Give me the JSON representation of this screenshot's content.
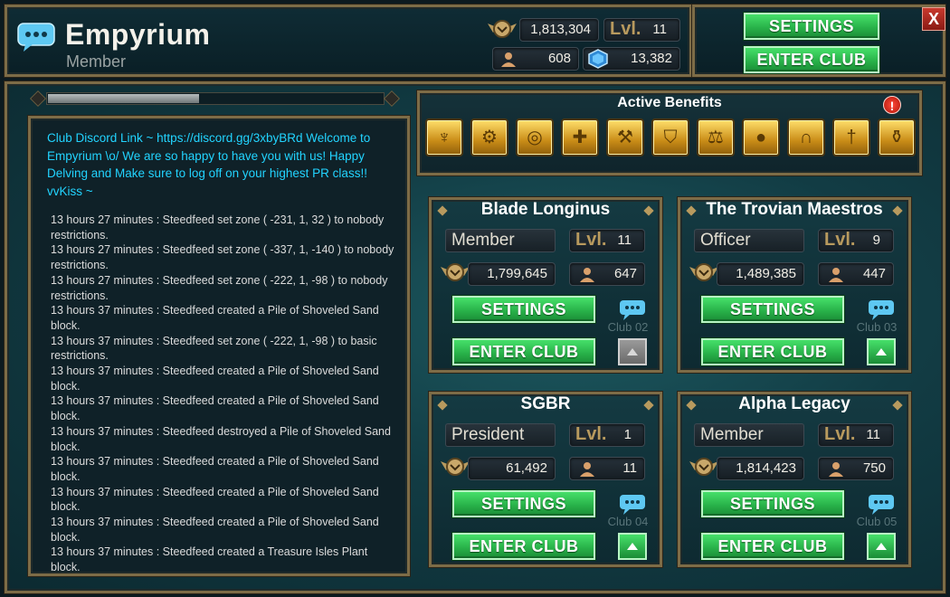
{
  "header": {
    "club_name": "Empyrium",
    "club_rank": "Member",
    "trophy_score": "1,813,304",
    "level_label": "Lvl.",
    "level_value": "11",
    "member_count": "608",
    "gem_count": "13,382",
    "settings_label": "SETTINGS",
    "enter_club_label": "ENTER CLUB",
    "close_label": "X"
  },
  "scroll": {
    "position": 0.45
  },
  "chat": {
    "motd": "Club Discord Link ~ https://discord.gg/3xbyBRd Welcome to Empyrium \\o/ We are so happy to have you with us! Happy Delving and Make sure to log off on your highest PR class!! vvKiss ~",
    "log": [
      "13 hours 27 minutes : Steedfeed set zone ( -231, 1, 32 ) to nobody restrictions.",
      "13 hours 27 minutes : Steedfeed set zone ( -337, 1, -140 ) to nobody restrictions.",
      "13 hours 27 minutes : Steedfeed set zone ( -222, 1, -98 ) to nobody restrictions.",
      "13 hours 37 minutes : Steedfeed created a Pile of Shoveled Sand block.",
      "13 hours 37 minutes : Steedfeed set zone ( -222, 1, -98 ) to basic restrictions.",
      "13 hours 37 minutes : Steedfeed created a Pile of Shoveled Sand block.",
      "13 hours 37 minutes : Steedfeed created a Pile of Shoveled Sand block.",
      "13 hours 37 minutes : Steedfeed destroyed a Pile of Shoveled Sand block.",
      "13 hours 37 minutes : Steedfeed created a Pile of Shoveled Sand block.",
      "13 hours 37 minutes : Steedfeed created a Pile of Shoveled Sand block.",
      "13 hours 37 minutes : Steedfeed created a Pile of Shoveled Sand block.",
      "13 hours 37 minutes : Steedfeed created a Treasure Isles Plant block."
    ]
  },
  "benefits": {
    "title": "Active Benefits",
    "alert": "!",
    "icons": [
      "torch-icon",
      "altar-icon",
      "target-icon",
      "signpost-icon",
      "axe-icon",
      "shield-icon",
      "scales-icon",
      "coins-icon",
      "horseshoe-icon",
      "sword-icon",
      "potion-icon"
    ],
    "glyphs": [
      "♆",
      "⚙",
      "◎",
      "✚",
      "⚒",
      "⛉",
      "⚖",
      "●",
      "∩",
      "†",
      "⚱"
    ]
  },
  "clubs": [
    {
      "name": "Blade Longinus",
      "rank": "Member",
      "level_label": "Lvl.",
      "level": "11",
      "trophy": "1,799,645",
      "members": "647",
      "settings": "SETTINGS",
      "enter": "ENTER CLUB",
      "slot": "Club 02",
      "arrow_enabled": false
    },
    {
      "name": "The Trovian Maestros",
      "rank": "Officer",
      "level_label": "Lvl.",
      "level": "9",
      "trophy": "1,489,385",
      "members": "447",
      "settings": "SETTINGS",
      "enter": "ENTER CLUB",
      "slot": "Club 03",
      "arrow_enabled": true
    },
    {
      "name": "SGBR",
      "rank": "President",
      "level_label": "Lvl.",
      "level": "1",
      "trophy": "61,492",
      "members": "11",
      "settings": "SETTINGS",
      "enter": "ENTER CLUB",
      "slot": "Club 04",
      "arrow_enabled": true
    },
    {
      "name": "Alpha Legacy",
      "rank": "Member",
      "level_label": "Lvl.",
      "level": "11",
      "trophy": "1,814,423",
      "members": "750",
      "settings": "SETTINGS",
      "enter": "ENTER CLUB",
      "slot": "Club 05",
      "arrow_enabled": true
    }
  ],
  "colors": {
    "accent_green": "#29b34a",
    "motd_cyan": "#22d4ff",
    "frame_gold": "#7d6c47",
    "level_gold": "#b89a5e"
  }
}
